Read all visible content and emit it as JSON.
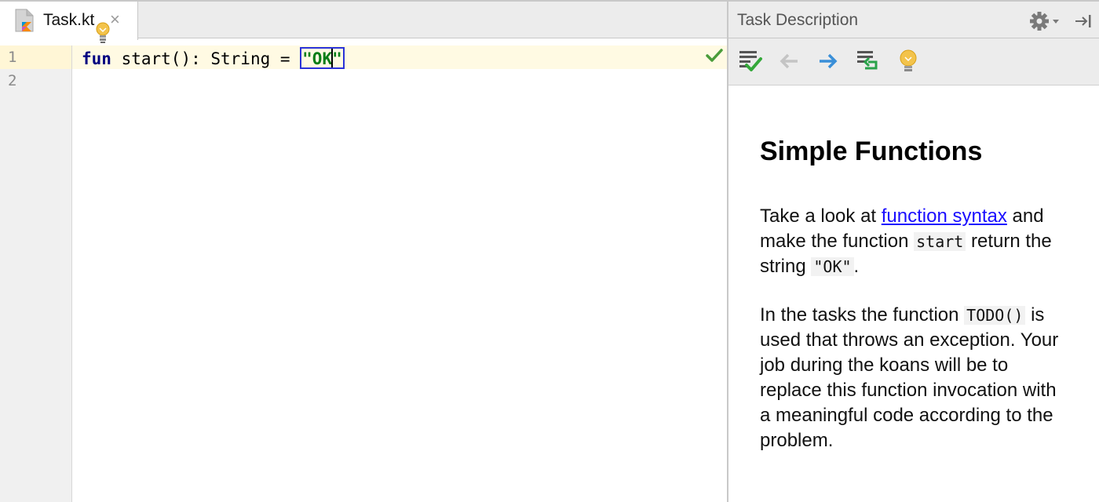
{
  "editor": {
    "tab": {
      "file_name": "Task.kt",
      "close": "×"
    },
    "line_numbers": [
      "1",
      "2"
    ],
    "code": {
      "keyword": "fun",
      "signature": " start(): String = ",
      "string_open": "\"OK",
      "string_close": "\""
    },
    "status": "check-ok"
  },
  "panel": {
    "title": "Task Description",
    "toolbar": [
      "check-task-icon",
      "previous-task-icon",
      "next-task-icon",
      "reset-task-icon",
      "hint-icon"
    ],
    "heading": "Simple Functions",
    "para1": {
      "pre": "Take a look at ",
      "link": "function syntax",
      "mid": " and make the function ",
      "code1": "start",
      "mid2": " return the string ",
      "code2": "\"OK\"",
      "end": "."
    },
    "para2": {
      "pre": "In the tasks the function ",
      "code": "TODO()",
      "post": " is used that throws an exception. Your job during the koans will be to replace this function invocation with a meaningful code according to the problem."
    }
  },
  "colors": {
    "keyword": "#000080",
    "string": "#067d17",
    "link": "#1a0dff",
    "current_line": "#fffae3"
  }
}
